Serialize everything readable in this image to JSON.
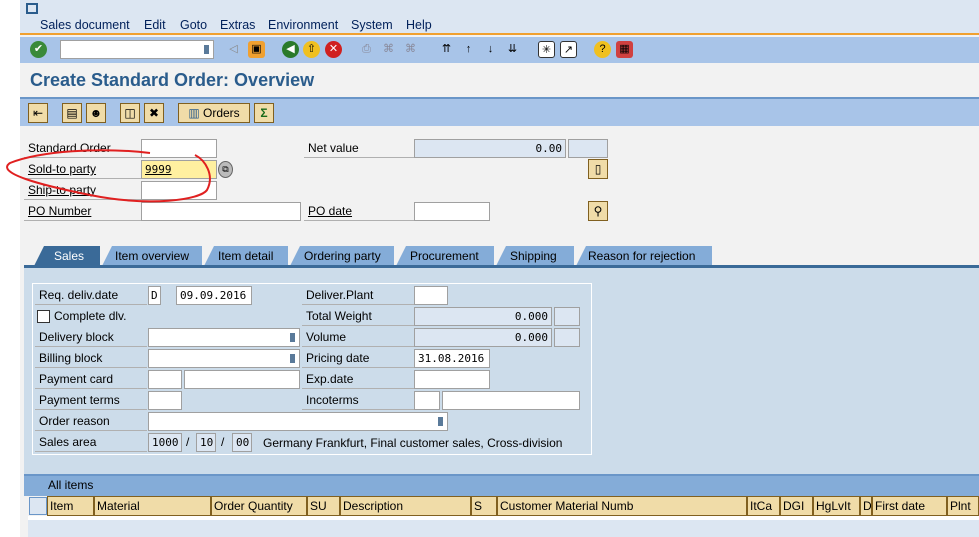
{
  "menu": [
    "Sales document",
    "Edit",
    "Goto",
    "Extras",
    "Environment",
    "System",
    "Help"
  ],
  "command_field": "",
  "title": "Create Standard Order: Overview",
  "app_toolbar": {
    "orders_label": "Orders"
  },
  "header": {
    "standard_order": {
      "label": "Standard Order",
      "value": ""
    },
    "sold_to": {
      "label": "Sold-to party",
      "value": "9999"
    },
    "ship_to": {
      "label": "Ship-to party",
      "value": ""
    },
    "po_number": {
      "label": "PO Number",
      "value": ""
    },
    "net_value": {
      "label": "Net value",
      "value": "0.00"
    },
    "po_date": {
      "label": "PO date",
      "value": ""
    }
  },
  "tabs": [
    "Sales",
    "Item overview",
    "Item detail",
    "Ordering party",
    "Procurement",
    "Shipping",
    "Reason for rejection"
  ],
  "sales": {
    "req_deliv": {
      "label": "Req. deliv.date",
      "type": "D",
      "value": "09.09.2016"
    },
    "complete_dlv": {
      "label": "Complete dlv.",
      "checked": false
    },
    "delivery_block": {
      "label": "Delivery block",
      "value": ""
    },
    "billing_block": {
      "label": "Billing block",
      "value": ""
    },
    "payment_card": {
      "label": "Payment card"
    },
    "payment_terms": {
      "label": "Payment terms"
    },
    "order_reason": {
      "label": "Order reason"
    },
    "sales_area": {
      "label": "Sales area",
      "org": "1000",
      "channel": "10",
      "division": "00",
      "sep": "/",
      "text": "Germany Frankfurt, Final customer sales, Cross-division"
    },
    "deliver_plant": {
      "label": "Deliver.Plant"
    },
    "total_weight": {
      "label": "Total Weight",
      "value": "0.000"
    },
    "volume": {
      "label": "Volume",
      "value": "0.000"
    },
    "pricing_date": {
      "label": "Pricing date",
      "value": "31.08.2016"
    },
    "exp_date": {
      "label": "Exp.date"
    },
    "incoterms": {
      "label": "Incoterms"
    }
  },
  "items": {
    "title": "All items",
    "columns": [
      "Item",
      "Material",
      "Order Quantity",
      "SU",
      "Description",
      "S",
      "Customer Material Numb",
      "ItCa",
      "DGI",
      "HgLvIt",
      "D",
      "First date",
      "Plnt"
    ]
  },
  "colors": {
    "accent": "#2a5c8c",
    "toolbar": "#a8c4e8",
    "annotation": "#e02020"
  }
}
